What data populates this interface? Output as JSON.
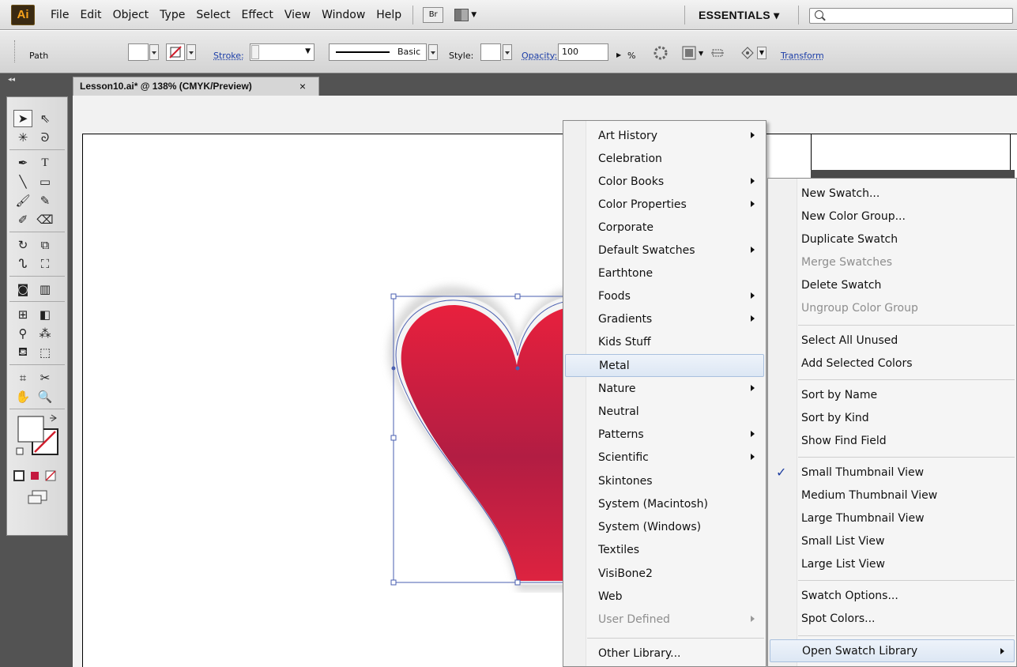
{
  "menubar": {
    "logo": "Ai",
    "items": [
      "File",
      "Edit",
      "Object",
      "Type",
      "Select",
      "Effect",
      "View",
      "Window",
      "Help"
    ],
    "bridge_label": "Br",
    "workspace": "ESSENTIALS ▾",
    "search_placeholder": ""
  },
  "control_bar": {
    "selection_type": "Path",
    "stroke_label": "Stroke:",
    "brush_label": "Basic",
    "style_label": "Style:",
    "opacity_label": "Opacity:",
    "opacity_value": "100",
    "percent": "%",
    "transform_label": "Transform"
  },
  "document": {
    "tab_title": "Lesson10.ai* @ 138% (CMYK/Preview)",
    "tab_close": "×"
  },
  "colors": {
    "heart_top": "#e8203d",
    "heart_bottom": "#b21d43",
    "selection": "#4a5fb0",
    "menu_highlight_border": "#a9c0de"
  },
  "library_menu": {
    "items": [
      {
        "label": "Art History",
        "submenu": true
      },
      {
        "label": "Celebration"
      },
      {
        "label": "Color Books",
        "submenu": true
      },
      {
        "label": "Color Properties",
        "submenu": true
      },
      {
        "label": "Corporate"
      },
      {
        "label": "Default Swatches",
        "submenu": true
      },
      {
        "label": "Earthtone"
      },
      {
        "label": "Foods",
        "submenu": true
      },
      {
        "label": "Gradients",
        "submenu": true
      },
      {
        "label": "Kids Stuff"
      },
      {
        "label": "Metal",
        "highlighted": true
      },
      {
        "label": "Nature",
        "submenu": true
      },
      {
        "label": "Neutral"
      },
      {
        "label": "Patterns",
        "submenu": true
      },
      {
        "label": "Scientific",
        "submenu": true
      },
      {
        "label": "Skintones"
      },
      {
        "label": "System (Macintosh)"
      },
      {
        "label": "System (Windows)"
      },
      {
        "label": "Textiles"
      },
      {
        "label": "VisiBone2"
      },
      {
        "label": "Web"
      },
      {
        "label": "User Defined",
        "submenu": true,
        "disabled": true
      },
      {
        "label": "Other Library..."
      }
    ]
  },
  "swatches_menu": {
    "items": [
      {
        "label": "New Swatch..."
      },
      {
        "label": "New Color Group..."
      },
      {
        "label": "Duplicate Swatch"
      },
      {
        "label": "Merge Swatches",
        "disabled": true
      },
      {
        "label": "Delete Swatch"
      },
      {
        "label": "Ungroup Color Group",
        "disabled": true
      },
      {
        "label": "Select All Unused"
      },
      {
        "label": "Add Selected Colors"
      },
      {
        "label": "Sort by Name"
      },
      {
        "label": "Sort by Kind"
      },
      {
        "label": "Show Find Field"
      },
      {
        "label": "Small Thumbnail View",
        "checked": true
      },
      {
        "label": "Medium Thumbnail View"
      },
      {
        "label": "Large Thumbnail View"
      },
      {
        "label": "Small List View"
      },
      {
        "label": "Large List View"
      },
      {
        "label": "Swatch Options..."
      },
      {
        "label": "Spot Colors..."
      },
      {
        "label": "Open Swatch Library",
        "submenu": true,
        "highlighted": true
      }
    ],
    "check_mark": "✓"
  }
}
